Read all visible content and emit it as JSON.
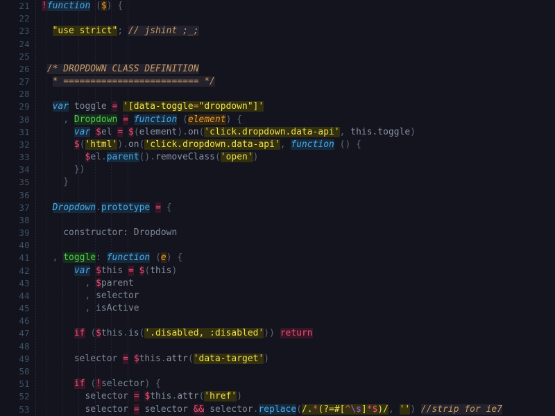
{
  "editor": {
    "name": "code-editor",
    "theme": "dark-rainbow-highlight",
    "language": "JavaScript",
    "background": "#14141f",
    "gutter_background": "#13131e",
    "line_number_color": "#3d5163",
    "first_line": 21,
    "last_line": 53,
    "line_height_px": 18.18,
    "font_size_px": 12.9
  },
  "colors": {
    "keyword": "#e8537a",
    "keyword_bg": "#3a1525",
    "builtin": "#4aa8e8",
    "builtin_bg": "#152a3d",
    "string": "#f0e050",
    "string_bg": "#33300f",
    "comment": "#c79b63",
    "comment_bg": "#24222c",
    "property": "#53c653",
    "property_bg": "#15311a",
    "param": "#e89a3c",
    "param_bg": "#33260f",
    "plain": "#7e8a99",
    "punctuation": "#5d6878"
  },
  "line_numbers": [
    21,
    22,
    23,
    24,
    25,
    26,
    27,
    28,
    29,
    30,
    31,
    32,
    33,
    34,
    35,
    36,
    37,
    38,
    39,
    40,
    41,
    42,
    43,
    44,
    45,
    46,
    47,
    48,
    49,
    50,
    51,
    52,
    53
  ],
  "code_lines": [
    {
      "number": 21,
      "text": "!function ($) {"
    },
    {
      "number": 22,
      "text": ""
    },
    {
      "number": 23,
      "text": "  \"use strict\"; // jshint ;_;"
    },
    {
      "number": 24,
      "text": ""
    },
    {
      "number": 25,
      "text": ""
    },
    {
      "number": 26,
      "text": " /* DROPDOWN CLASS DEFINITION"
    },
    {
      "number": 27,
      "text": "  * ========================= */"
    },
    {
      "number": 28,
      "text": ""
    },
    {
      "number": 29,
      "text": "  var toggle = '[data-toggle=\"dropdown\"]'"
    },
    {
      "number": 30,
      "text": "    , Dropdown = function (element) {"
    },
    {
      "number": 31,
      "text": "      var $el = $(element).on('click.dropdown.data-api', this.toggle)"
    },
    {
      "number": 32,
      "text": "      $('html').on('click.dropdown.data-api', function () {"
    },
    {
      "number": 33,
      "text": "        $el.parent().removeClass('open')"
    },
    {
      "number": 34,
      "text": "      })"
    },
    {
      "number": 35,
      "text": "    }"
    },
    {
      "number": 36,
      "text": ""
    },
    {
      "number": 37,
      "text": "  Dropdown.prototype = {"
    },
    {
      "number": 38,
      "text": ""
    },
    {
      "number": 39,
      "text": "    constructor: Dropdown"
    },
    {
      "number": 40,
      "text": ""
    },
    {
      "number": 41,
      "text": "  , toggle: function (e) {"
    },
    {
      "number": 42,
      "text": "      var $this = $(this)"
    },
    {
      "number": 43,
      "text": "        , $parent"
    },
    {
      "number": 44,
      "text": "        , selector"
    },
    {
      "number": 45,
      "text": "        , isActive"
    },
    {
      "number": 46,
      "text": ""
    },
    {
      "number": 47,
      "text": "      if ($this.is('.disabled, :disabled')) return"
    },
    {
      "number": 48,
      "text": ""
    },
    {
      "number": 49,
      "text": "      selector = $this.attr('data-target')"
    },
    {
      "number": 50,
      "text": ""
    },
    {
      "number": 51,
      "text": "      if (!selector) {"
    },
    {
      "number": 52,
      "text": "        selector = $this.attr('href')"
    },
    {
      "number": 53,
      "text": "        selector = selector && selector.replace(/.*(?=#[^\\s]*$)/, '') //strip for ie7"
    }
  ]
}
